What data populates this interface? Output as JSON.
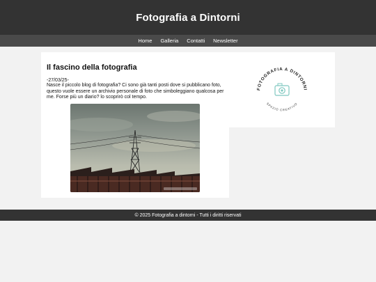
{
  "header": {
    "title": "Fotografia a Dintorni"
  },
  "nav": {
    "items": [
      {
        "label": "Home"
      },
      {
        "label": "Galleria"
      },
      {
        "label": "Contatti"
      },
      {
        "label": "Newsletter"
      }
    ]
  },
  "post": {
    "title": "Il fascino della fotografia",
    "date": "-27/03/25-",
    "body": "Nasce il piccolo blog di fotografia? Ci sono già tanti posti dove si pubblicano foto, questo vuole essere un archivio personale di foto che simboleggiano qualcosa per me. Forse più un diario? lo scoprirò col tempo."
  },
  "logo": {
    "arc_top": "FOTOGRAFIA A DINTORNI",
    "arc_bottom": "SPAZIO CREATIVO",
    "icon": "camera-icon"
  },
  "footer": {
    "text": "© 2025 Fotografia a dintorni - Tutti i diritti riservati"
  },
  "colors": {
    "header_bg": "#333333",
    "nav_bg": "#4a4a4a",
    "page_bg": "#f2f2f2",
    "card_bg": "#ffffff",
    "logo_accent": "#7fc8c0"
  }
}
